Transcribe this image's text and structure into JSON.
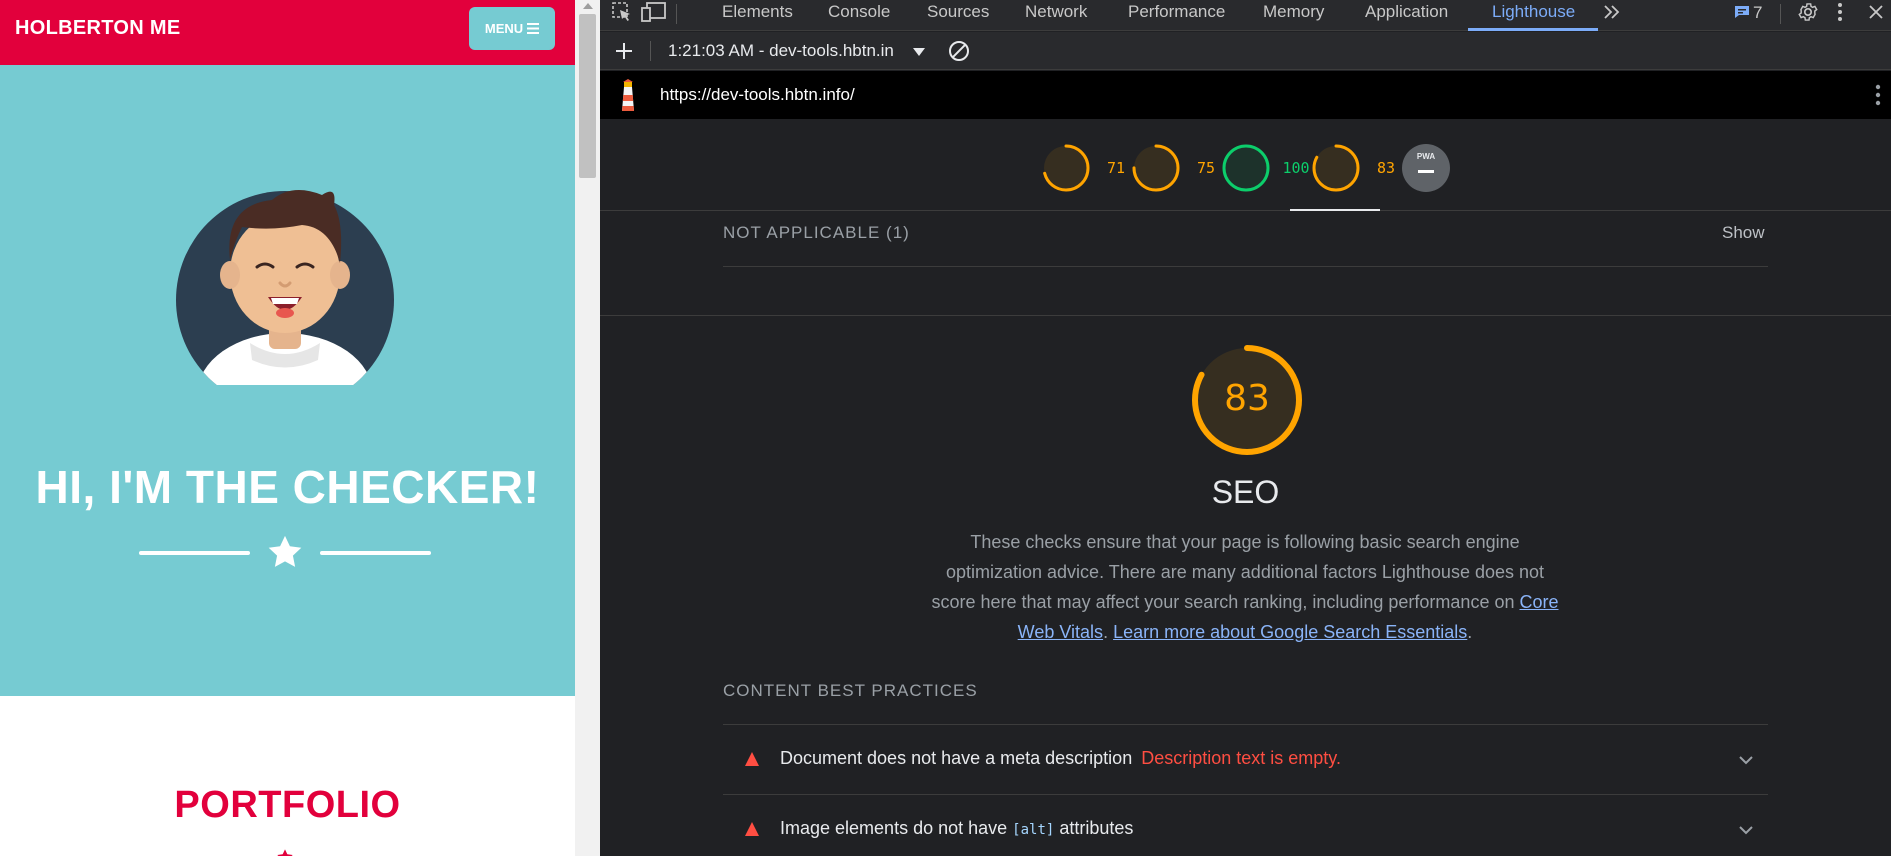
{
  "page": {
    "brand": "HOLBERTON ME",
    "menu_label": "MENU",
    "masthead_title": "HI, I'M THE CHECKER!",
    "portfolio_title": "PORTFOLIO",
    "colors": {
      "primary": "#e2003c",
      "teal": "#76cbd2"
    }
  },
  "devtools": {
    "tabs": [
      "Elements",
      "Console",
      "Sources",
      "Network",
      "Performance",
      "Memory",
      "Application",
      "Lighthouse"
    ],
    "active_tab": "Lighthouse",
    "issues_count": "7",
    "session": "1:21:03 AM - dev-tools.hbtn.in",
    "url": "https://dev-tools.hbtn.info/",
    "gauges": [
      {
        "score": "71",
        "value": 0.71,
        "color": "#ffa400"
      },
      {
        "score": "75",
        "value": 0.75,
        "color": "#ffa400"
      },
      {
        "score": "100",
        "value": 1.0,
        "color": "#0cce6b"
      },
      {
        "score": "83",
        "value": 0.83,
        "color": "#ffa400"
      }
    ],
    "pwa_label": "PWA",
    "not_applicable": "NOT APPLICABLE (1)",
    "show_label": "Show",
    "seo": {
      "score": "83",
      "value": 0.83,
      "title": "SEO",
      "desc": "These checks ensure that your page is following basic search engine optimization advice. There are many additional factors Lighthouse does not score here that may affect your search ranking, including performance on ",
      "link1": "Core Web Vitals",
      "sep": ". ",
      "link2": "Learn more about Google Search Essentials",
      "end": "."
    },
    "group_title": "CONTENT BEST PRACTICES",
    "audits": [
      {
        "title": "Document does not have a meta description",
        "error": "Description text is empty."
      },
      {
        "title_before": "Image elements do not have ",
        "code": "[alt]",
        "title_after": " attributes"
      }
    ]
  }
}
